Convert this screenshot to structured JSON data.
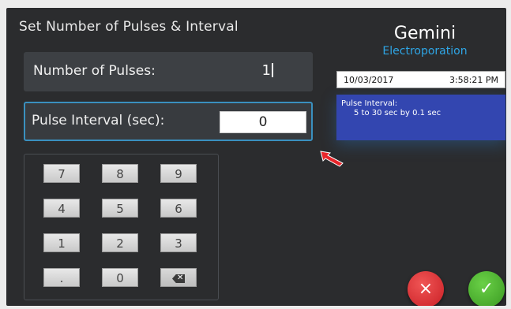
{
  "screen": {
    "title": "Set Number of Pulses & Interval",
    "brand": {
      "name": "Gemini",
      "subtitle": "Electroporation"
    }
  },
  "fields": {
    "pulses": {
      "label": "Number of Pulses:",
      "value": "1"
    },
    "interval": {
      "label": "Pulse Interval (sec):",
      "value": "0"
    }
  },
  "keypad": {
    "keys": [
      "7",
      "8",
      "9",
      "4",
      "5",
      "6",
      "1",
      "2",
      "3",
      ".",
      "0"
    ],
    "backspace_icon": "backspace-icon"
  },
  "status": {
    "date": "10/03/2017",
    "time": "3:58:21 PM"
  },
  "info": {
    "title": "Pulse Interval:",
    "range": "5 to 30 sec by 0.1 sec"
  },
  "actions": {
    "cancel_label": "×",
    "confirm_label": "✓",
    "cancel_color": "#d9262c",
    "confirm_color": "#49b02c"
  },
  "colors": {
    "accent": "#2ea6e6",
    "info_bg": "#3346b0",
    "pointer": "#e8262b"
  }
}
